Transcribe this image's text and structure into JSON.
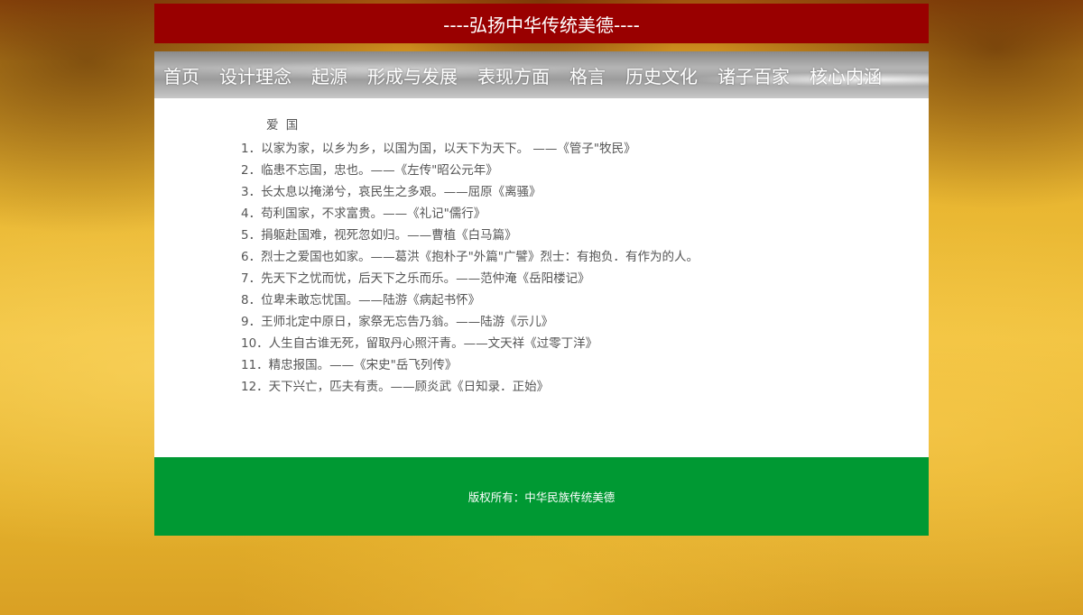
{
  "header": {
    "title": "----弘扬中华传统美德----"
  },
  "nav": {
    "items": [
      "首页",
      "设计理念",
      "起源",
      "形成与发展",
      "表现方面",
      "格言",
      "历史文化",
      "诸子百家",
      "核心内涵"
    ]
  },
  "content": {
    "section_title": "爱 国",
    "quotes": [
      "1．以家为家，以乡为乡，以国为国，以天下为天下。 ——《管子\"牧民》",
      "2．临患不忘国，忠也。——《左传\"昭公元年》",
      "3．长太息以掩涕兮，哀民生之多艰。——屈原《离骚》",
      "4．苟利国家，不求富贵。——《礼记\"儒行》",
      "5．捐躯赴国难，视死忽如归。——曹植《白马篇》",
      "6．烈士之爱国也如家。——葛洪《抱朴子\"外篇\"广譬》烈士：有抱负．有作为的人。",
      "7．先天下之忧而忧，后天下之乐而乐。——范仲淹《岳阳楼记》",
      "8．位卑未敢忘忧国。——陆游《病起书怀》",
      "9．王师北定中原日，家祭无忘告乃翁。——陆游《示儿》",
      "10．人生自古谁无死，留取丹心照汗青。——文天祥《过零丁洋》",
      "11．精忠报国。——《宋史\"岳飞列传》",
      "12．天下兴亡，匹夫有责。——顾炎武《日知录．正始》"
    ]
  },
  "footer": {
    "copyright": "版权所有：中华民族传统美德"
  },
  "colors": {
    "title_bar": "#990000",
    "footer": "#009933",
    "content_bg": "#ffffff",
    "text": "#555555"
  }
}
